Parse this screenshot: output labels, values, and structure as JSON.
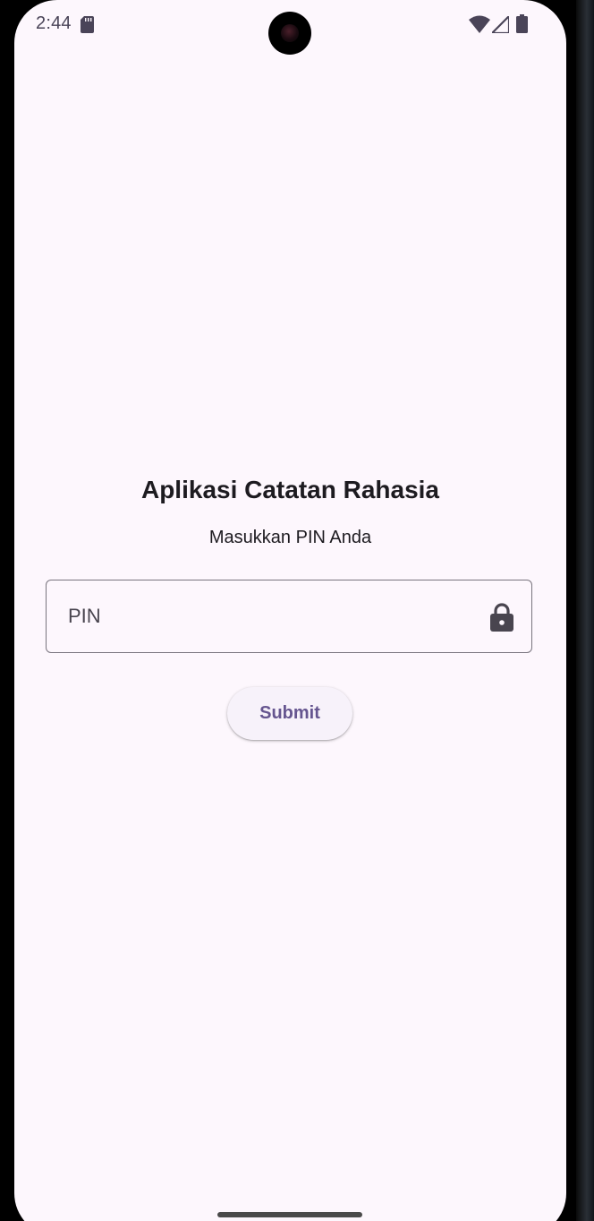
{
  "status_bar": {
    "time": "2:44",
    "icons": [
      "sd-card-icon",
      "wifi-icon",
      "cellular-signal-icon",
      "battery-icon"
    ]
  },
  "app": {
    "title": "Aplikasi Catatan Rahasia",
    "subtitle": "Masukkan PIN Anda"
  },
  "pin_field": {
    "placeholder": "PIN",
    "value": "",
    "trailing_icon": "lock-icon"
  },
  "submit_button": {
    "label": "Submit"
  },
  "colors": {
    "background": "#fdf7fd",
    "primary": "#65558f",
    "on_surface": "#1d1b20",
    "outline": "#79747e",
    "button_container": "#f7f2fa"
  }
}
